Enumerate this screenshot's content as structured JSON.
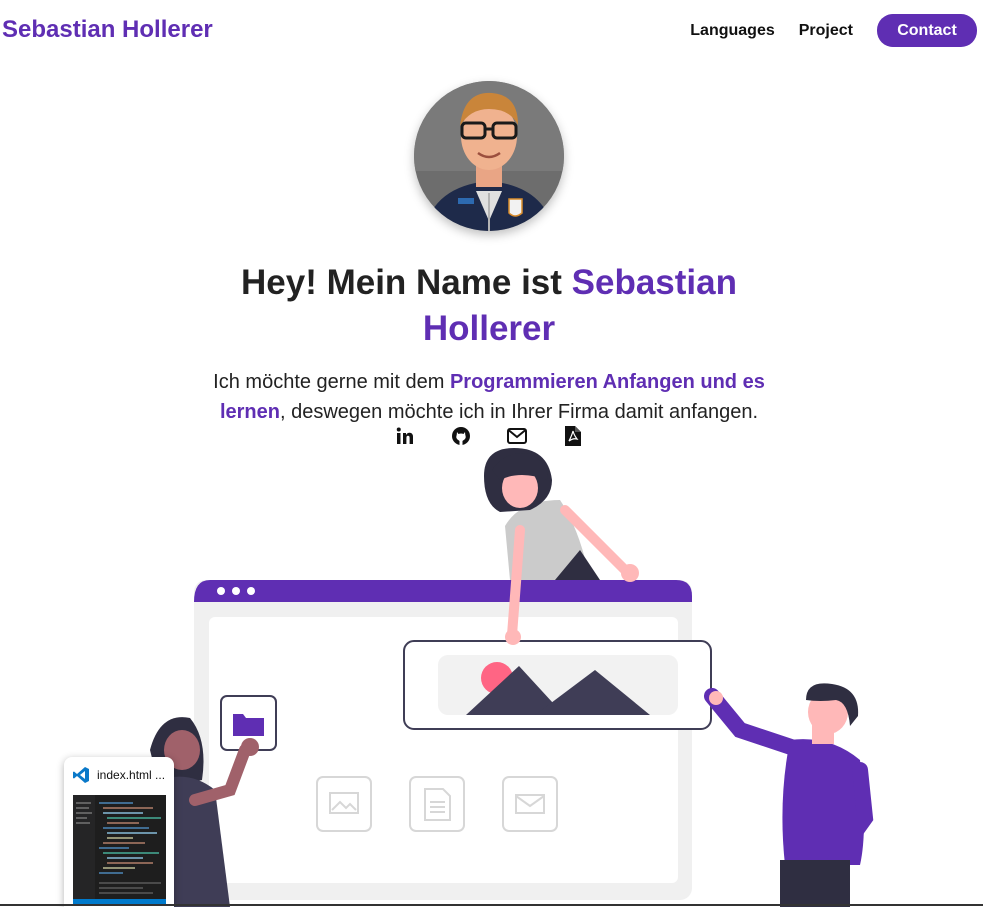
{
  "header": {
    "brand": "Sebastian Hollerer",
    "nav": [
      {
        "label": "Languages"
      },
      {
        "label": "Project"
      }
    ],
    "contact_label": "Contact"
  },
  "hero": {
    "headline_prefix": "Hey! Mein Name ist ",
    "headline_name": "Sebastian Hollerer",
    "intro_prefix": "Ich möchte gerne mit dem ",
    "intro_highlight": "Programmieren Anfangen und es lernen",
    "intro_suffix": ", deswegen möchte ich in Ihrer Firma damit anfangen."
  },
  "socials": [
    "linkedin-icon",
    "github-icon",
    "mail-icon",
    "pdf-icon"
  ],
  "taskbar_preview": {
    "title": "index.html ..."
  },
  "colors": {
    "accent": "#5f2eb3",
    "text": "#222222"
  }
}
